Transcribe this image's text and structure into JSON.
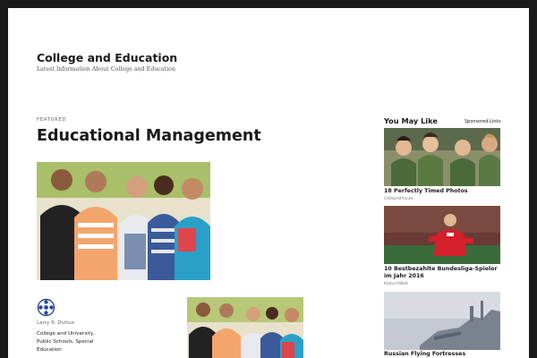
{
  "site": {
    "title": "College and Education",
    "description": "Latest Information About College and Education"
  },
  "post": {
    "featured_label": "FEATURED",
    "title": "Educational Management",
    "author": "Larry R. Dufour",
    "categories": "College and University, Public Schools, Special Education"
  },
  "sidebar": {
    "title": "You May Like",
    "sponsored": "Sponsored Links",
    "ads": [
      {
        "title": "18 Perfectly Timed Photos",
        "source": "CelebritPlanet"
      },
      {
        "title": "10 Bestbezahlte Bundesliga-Spieler im Jahr 2016",
        "source": "KlatschWelt"
      },
      {
        "title": "Russian Flying Fortresses",
        "source": ""
      }
    ]
  },
  "colors": {
    "frame": "#1a1a1a",
    "background": "#ffffff",
    "text": "#1a1a1a"
  }
}
